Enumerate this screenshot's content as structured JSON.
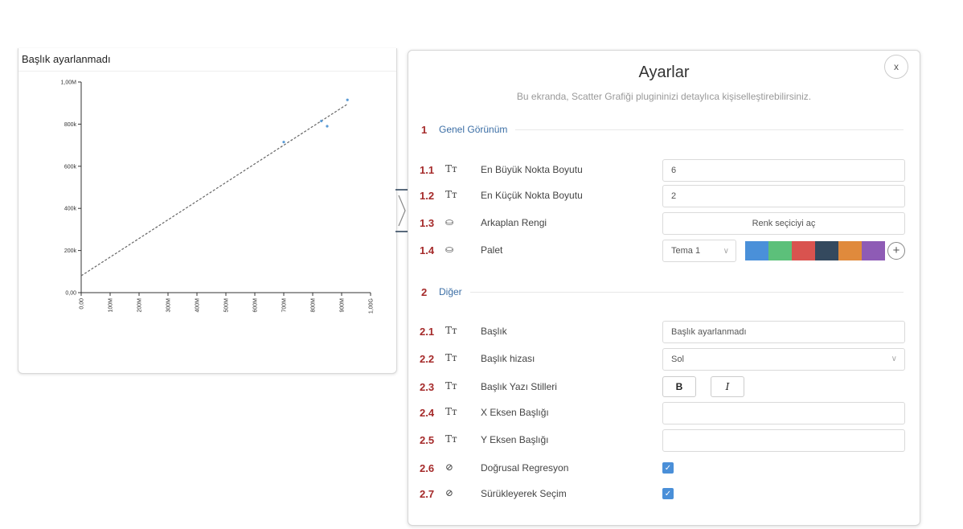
{
  "chart": {
    "title": "Başlık ayarlanmadı"
  },
  "chart_data": {
    "type": "scatter",
    "title": "Başlık ayarlanmadı",
    "xlabel": "",
    "ylabel": "",
    "xlim": [
      0,
      1000000
    ],
    "ylim": [
      0,
      1000000
    ],
    "x_ticks": [
      "0,00",
      "100M",
      "200M",
      "300M",
      "400M",
      "500M",
      "600M",
      "700M",
      "800M",
      "900M",
      "1,00G"
    ],
    "y_ticks": [
      "0,00",
      "200k",
      "400k",
      "600k",
      "800k",
      "1,00M"
    ],
    "x_tick_values": [
      0,
      100000,
      200000,
      300000,
      400000,
      500000,
      600000,
      700000,
      800000,
      900000,
      1000000
    ],
    "y_tick_values": [
      0,
      200000,
      400000,
      600000,
      800000,
      1000000
    ],
    "points": [
      {
        "x": 700000,
        "y": 715000
      },
      {
        "x": 830000,
        "y": 815000
      },
      {
        "x": 850000,
        "y": 790000
      },
      {
        "x": 920000,
        "y": 915000
      }
    ],
    "regression": {
      "x": [
        0,
        920000
      ],
      "y": [
        80000,
        895000
      ]
    },
    "point_color": "#5b9bd5",
    "regression_color": "#666666",
    "grid": false
  },
  "panel": {
    "title": "Ayarlar",
    "subtitle": "Bu ekranda, Scatter Grafiği plugininizi detaylıca kişiselleştirebilirsiniz.",
    "close_label": "x"
  },
  "sections": [
    {
      "num": "1",
      "label": "Genel Görünüm"
    },
    {
      "num": "2",
      "label": "Diğer"
    }
  ],
  "rows": {
    "r1_1": {
      "num": "1.1",
      "icon": "Tт",
      "label": "En Büyük Nokta Boyutu",
      "value": "6"
    },
    "r1_2": {
      "num": "1.2",
      "icon": "Tт",
      "label": "En Küçük Nokta Boyutu",
      "value": "2"
    },
    "r1_3": {
      "num": "1.3",
      "icon": "⛀",
      "label": "Arkaplan Rengi",
      "button": "Renk seçiciyi aç"
    },
    "r1_4": {
      "num": "1.4",
      "icon": "⛀",
      "label": "Palet",
      "theme": "Tema 1"
    },
    "r2_1": {
      "num": "2.1",
      "icon": "Tт",
      "label": "Başlık",
      "value": "Başlık ayarlanmadı"
    },
    "r2_2": {
      "num": "2.2",
      "icon": "Tт",
      "label": "Başlık hizası",
      "value": "Sol"
    },
    "r2_3": {
      "num": "2.3",
      "icon": "Tт",
      "label": "Başlık Yazı Stilleri",
      "bold": "B",
      "italic": "I"
    },
    "r2_4": {
      "num": "2.4",
      "icon": "Tт",
      "label": "X Eksen Başlığı",
      "value": ""
    },
    "r2_5": {
      "num": "2.5",
      "icon": "Tт",
      "label": "Y Eksen Başlığı",
      "value": ""
    },
    "r2_6": {
      "num": "2.6",
      "icon": "⊘",
      "label": "Doğrusal Regresyon",
      "checked": true
    },
    "r2_7": {
      "num": "2.7",
      "icon": "⊘",
      "label": "Sürükleyerek Seçim",
      "checked": true
    }
  },
  "palette_colors": [
    "#4a90d9",
    "#5cc07a",
    "#d9534f",
    "#34495e",
    "#e08a3c",
    "#8e5bb5"
  ],
  "colors": {
    "accent_number": "#a52a2a",
    "section_label": "#3b6ea5",
    "checkbox": "#4a8fd8"
  }
}
